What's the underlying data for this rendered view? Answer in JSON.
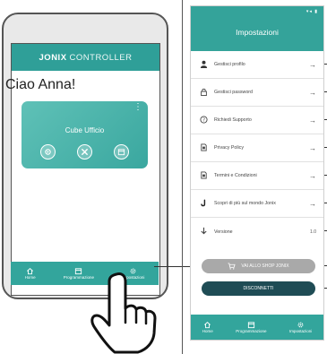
{
  "left_phone": {
    "brand_bold": "JONIX",
    "brand_rest": "CONTROLLER",
    "greeting": "Ciao Anna!",
    "device_card": {
      "name": "Cube Ufficio",
      "menu_glyph": "⋮"
    },
    "nav": [
      {
        "label": "Home",
        "icon": "home-icon"
      },
      {
        "label": "Programmazione",
        "icon": "calendar-icon"
      },
      {
        "label": "Impostazioni",
        "icon": "gear-icon"
      }
    ]
  },
  "settings": {
    "status": "▾◂ ▮",
    "title": "Impostazioni",
    "rows": [
      {
        "label": "Gestisci profilo",
        "icon": "user-icon",
        "arrow": "→"
      },
      {
        "label": "Gestisci password",
        "icon": "lock-icon",
        "arrow": "→"
      },
      {
        "label": "Richiedi Supporto",
        "icon": "help-icon",
        "arrow": "→"
      },
      {
        "label": "Privacy Policy",
        "icon": "document-icon",
        "arrow": "→"
      },
      {
        "label": "Termini e Condizioni",
        "icon": "document-icon",
        "arrow": "→"
      },
      {
        "label": "Scopri di più sul mondo Jonix",
        "icon": "jonix-logo-icon",
        "arrow": "→"
      },
      {
        "label": "Versione",
        "icon": "download-arrow-icon",
        "value": "1.0"
      }
    ],
    "shop_button": "VAI ALLO SHOP JONIX",
    "logout_button": "DISCONNETTI",
    "nav": [
      {
        "label": "Home",
        "icon": "home-icon"
      },
      {
        "label": "Programmazione",
        "icon": "calendar-icon"
      },
      {
        "label": "Impostazioni",
        "icon": "gear-icon"
      }
    ]
  },
  "colors": {
    "teal": "#34a39a",
    "teal_card": "#4db4ab",
    "dark_button": "#1f4c55",
    "grey_button": "#a9a9a9"
  }
}
